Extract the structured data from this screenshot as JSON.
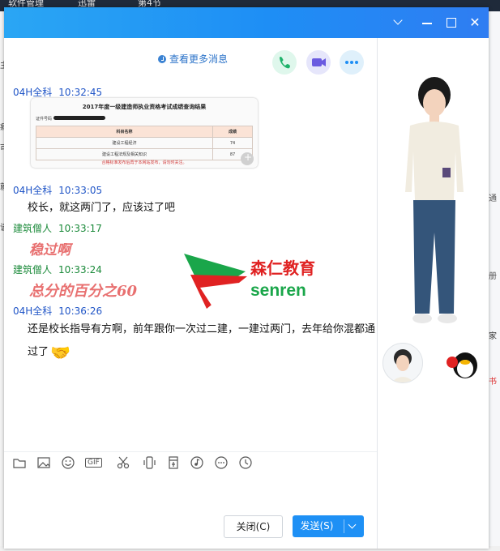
{
  "background": {
    "menu_items": [
      "软件管理",
      "迅雷",
      "第4节"
    ],
    "left_glyphs": [
      "主",
      "病",
      "可",
      "就",
      "谈"
    ],
    "right_texts": [
      "通",
      "册",
      "家",
      "书"
    ]
  },
  "window": {
    "buttons": [
      "chevron-down",
      "minimize",
      "maximize",
      "close"
    ]
  },
  "chat": {
    "more_messages": "查看更多消息",
    "messages": [
      {
        "sender": "04H全科",
        "time": "10:32:45",
        "color": "#2156c7"
      },
      {
        "sender": "04H全科",
        "time": "10:33:05",
        "color": "#2156c7",
        "text": "校长，就这两门了，应该过了吧"
      },
      {
        "sender": "建筑僧人",
        "time": "10:33:17",
        "color": "#1b8a3a"
      },
      {
        "sender": "建筑僧人",
        "time": "10:33:24",
        "color": "#1b8a3a"
      },
      {
        "sender": "04H全科",
        "time": "10:36:26",
        "color": "#2156c7",
        "text_line1": "还是校长指导有方啊，前年跟你一次过二建，一建过两门，去年给你混都通",
        "text_line2": "过了"
      }
    ],
    "image_card": {
      "title": "2017年度一级建造师执业资格考试成绩查询结果",
      "id_label": "证件号码",
      "headers": [
        "科目名称",
        "成绩"
      ],
      "rows": [
        [
          "建设工程经济",
          "74"
        ],
        [
          "建设工程法规及相关知识",
          "87"
        ]
      ],
      "note": "合格标准发布后再于本网站发布，请勿时关注。"
    }
  },
  "annotations": {
    "wen_guo": "稳过啊",
    "zong_fen": "总分的百分之60"
  },
  "logo": {
    "name_cn": "森仁教育",
    "name_en": "senren"
  },
  "toolbar": {
    "gif": "GIF"
  },
  "footer": {
    "close_label": "关闭(C)",
    "send_label": "发送(S)"
  },
  "colors": {
    "title_bar": "#1e8ef5",
    "send_button": "#1e90f5",
    "sender_blue": "#2156c7",
    "sender_green": "#1b8a3a",
    "annotation_red": "#e87070",
    "logo_red": "#e02222",
    "logo_green": "#1aa64a"
  }
}
